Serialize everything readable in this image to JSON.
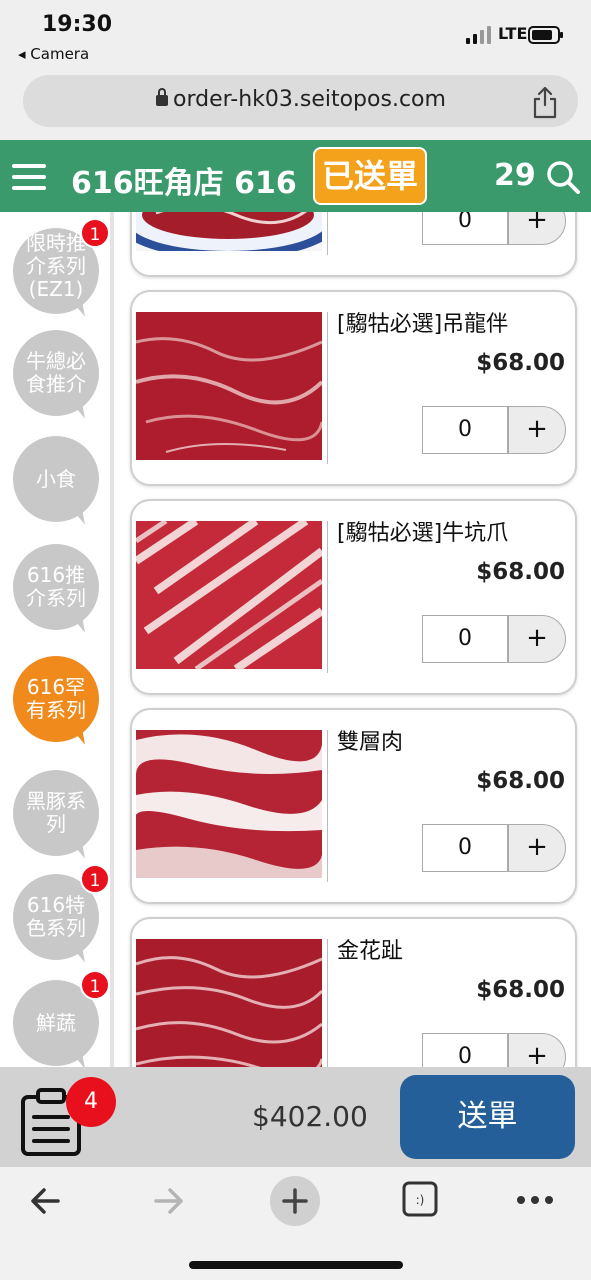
{
  "status": {
    "time": "19:30",
    "back_app": "◂ Camera",
    "network": "LTE"
  },
  "browser": {
    "url": "order-hk03.seitopos.com"
  },
  "header": {
    "shop_name": "616旺角店 616",
    "status_badge": "已送單",
    "count": "29"
  },
  "sidebar": {
    "items": [
      {
        "label": "限時推介系列(EZ1)",
        "badge": "1",
        "active": false
      },
      {
        "label": "牛總必食推介",
        "badge": "",
        "active": false
      },
      {
        "label": "小食",
        "badge": "",
        "active": false
      },
      {
        "label": "616推介系列",
        "badge": "",
        "active": false
      },
      {
        "label": "616罕有系列",
        "badge": "",
        "active": true
      },
      {
        "label": "黑豚系列",
        "badge": "",
        "active": false
      },
      {
        "label": "616特色系列",
        "badge": "1",
        "active": false
      },
      {
        "label": "鮮蔬",
        "badge": "1",
        "active": false
      }
    ]
  },
  "products": [
    {
      "name": "",
      "price": "",
      "qty": "0",
      "plus": "+"
    },
    {
      "name": "[騶牯必選]吊龍伴",
      "price": "$68.00",
      "qty": "0",
      "plus": "+"
    },
    {
      "name": "[騶牯必選]牛坑爪",
      "price": "$68.00",
      "qty": "0",
      "plus": "+"
    },
    {
      "name": "雙層肉",
      "price": "$68.00",
      "qty": "0",
      "plus": "+"
    },
    {
      "name": "金花趾",
      "price": "$68.00",
      "qty": "0",
      "plus": "+"
    }
  ],
  "cart": {
    "badge": "4",
    "total": "$402.00",
    "send_label": "送單"
  },
  "colors": {
    "header_green": "#3a9a6c",
    "badge_orange": "#f4a11c",
    "active_orange": "#f08a1c",
    "send_blue": "#245f9a",
    "alert_red": "#e8101c"
  }
}
